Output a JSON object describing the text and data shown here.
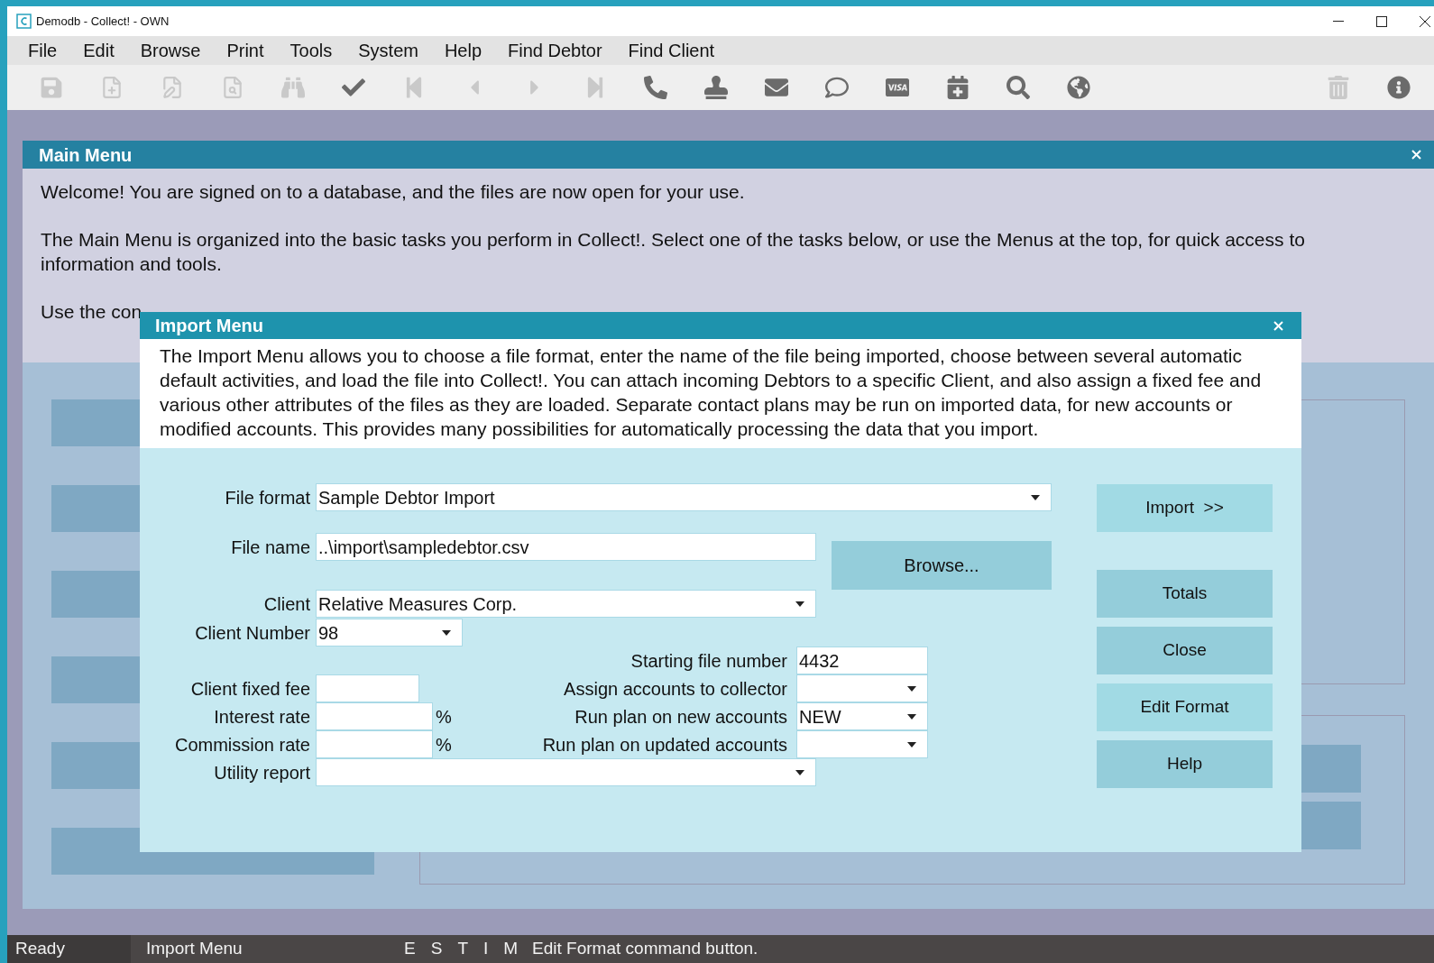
{
  "window": {
    "title": "Demodb - Collect! - OWN"
  },
  "menu": [
    "File",
    "Edit",
    "Browse",
    "Print",
    "Tools",
    "System",
    "Help",
    "Find Debtor",
    "Find Client"
  ],
  "toolbar": [
    {
      "kind": "save",
      "disabled": true
    },
    {
      "kind": "new",
      "disabled": true
    },
    {
      "kind": "edit",
      "disabled": true
    },
    {
      "kind": "preview",
      "disabled": true
    },
    {
      "kind": "find",
      "disabled": true
    },
    {
      "kind": "check",
      "disabled": false
    },
    {
      "kind": "first",
      "disabled": true
    },
    {
      "kind": "prev",
      "disabled": true
    },
    {
      "kind": "next",
      "disabled": true
    },
    {
      "kind": "last",
      "disabled": true
    },
    {
      "kind": "phone",
      "disabled": false
    },
    {
      "kind": "stamp",
      "disabled": false
    },
    {
      "kind": "mail",
      "disabled": false
    },
    {
      "kind": "chat",
      "disabled": false
    },
    {
      "kind": "card",
      "disabled": false
    },
    {
      "kind": "calendar",
      "disabled": false
    },
    {
      "kind": "search",
      "disabled": false
    },
    {
      "kind": "globe",
      "disabled": false
    }
  ],
  "toolbar_right": [
    {
      "kind": "trash",
      "disabled": true
    },
    {
      "kind": "info",
      "disabled": false
    }
  ],
  "main_menu": {
    "title": "Main Menu",
    "paragraphs": [
      "Welcome! You are signed on to a database, and the files are now open for your use.",
      "The Main Menu is organized into the basic tasks you perform in Collect!. Select one of the tasks below, or use the Menus at the top, for quick access to information and tools.",
      "Use the con"
    ]
  },
  "import_dialog": {
    "title": "Import Menu",
    "description": "The Import Menu allows you to choose a file format, enter the name of the file being imported, choose between several automatic default activities, and load the file into Collect!. You can attach incoming Debtors to a specific Client, and also assign a fixed fee and various other attributes of the files as they are loaded. Separate contact plans may be run on imported data, for new accounts or modified accounts. This provides many possibilities for automatically processing the data that you import.",
    "file_format": {
      "label": "File format",
      "kind": "dropdown",
      "value": "Sample Debtor Import"
    },
    "file_name": {
      "label": "File name",
      "kind": "text",
      "value": "..\\import\\sampledebtor.csv"
    },
    "browse_button": "Browse...",
    "client": {
      "label": "Client",
      "kind": "dropdown",
      "value": "Relative Measures Corp."
    },
    "client_number": {
      "label": "Client Number",
      "kind": "dropdown",
      "value": "98"
    },
    "starting_file_number": {
      "label": "Starting file number",
      "kind": "text",
      "value": "4432"
    },
    "client_fixed_fee": {
      "label": "Client fixed fee",
      "kind": "text"
    },
    "assign_accounts_to_collector": {
      "label": "Assign accounts to collector",
      "kind": "dropdown"
    },
    "interest_rate": {
      "label": "Interest rate",
      "kind": "text",
      "suffix": "%"
    },
    "run_plan_on_new_accounts": {
      "label": "Run plan on new accounts",
      "kind": "dropdown",
      "value": "NEW"
    },
    "commission_rate": {
      "label": "Commission rate",
      "kind": "text",
      "suffix": "%"
    },
    "run_plan_on_updated_accounts": {
      "label": "Run plan on updated accounts",
      "kind": "dropdown"
    },
    "utility_report": {
      "label": "Utility report",
      "kind": "dropdown"
    },
    "buttons": [
      {
        "label": "Import  >>",
        "highlighted": true
      },
      {
        "label": "Totals",
        "highlighted": false
      },
      {
        "label": "Close",
        "highlighted": false
      },
      {
        "label": "Edit Format",
        "highlighted": true
      },
      {
        "label": "Help",
        "highlighted": false
      }
    ]
  },
  "status_bar": {
    "state": "Ready",
    "form": "Import Menu",
    "flags": [
      "E",
      "S",
      "T",
      "I",
      "M"
    ],
    "message": "Edit Format command button."
  }
}
